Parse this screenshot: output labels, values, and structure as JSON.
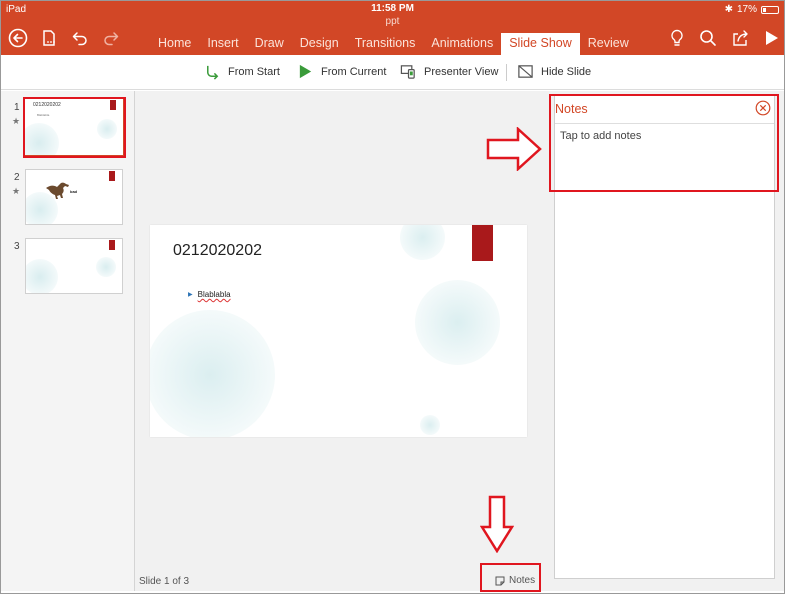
{
  "status_bar": {
    "device": "iPad",
    "time": "11:58 PM",
    "bluetooth": "✱",
    "battery": "17%"
  },
  "document": {
    "title": "ppt"
  },
  "toolbar": {
    "icons": [
      "back-arrow-icon",
      "file-icon",
      "undo-icon",
      "redo-icon",
      "lightbulb-icon",
      "search-icon",
      "share-icon",
      "play-icon"
    ]
  },
  "tabs": [
    {
      "label": "Home"
    },
    {
      "label": "Insert"
    },
    {
      "label": "Draw"
    },
    {
      "label": "Design"
    },
    {
      "label": "Transitions"
    },
    {
      "label": "Animations"
    },
    {
      "label": "Slide Show",
      "active": true
    },
    {
      "label": "Review"
    }
  ],
  "ribbon": {
    "from_start": "From Start",
    "from_current": "From Current",
    "presenter_view": "Presenter View",
    "hide_slide": "Hide Slide"
  },
  "thumbnails": [
    {
      "number": "1",
      "starred": true,
      "title": "0212020202",
      "bullet": "Blablabla",
      "selected": true
    },
    {
      "number": "2",
      "starred": true,
      "caption": "bad"
    },
    {
      "number": "3",
      "starred": false
    }
  ],
  "slide": {
    "title": "0212020202",
    "bullet": "Blablabla",
    "accent_color": "#a9191b"
  },
  "footer": {
    "slide_counter": "Slide 1 of 3",
    "notes_label": "Notes"
  },
  "notes_panel": {
    "title": "Notes",
    "placeholder": "Tap to add notes"
  },
  "colors": {
    "brand": "#d24726",
    "annotation": "#e0161f"
  }
}
